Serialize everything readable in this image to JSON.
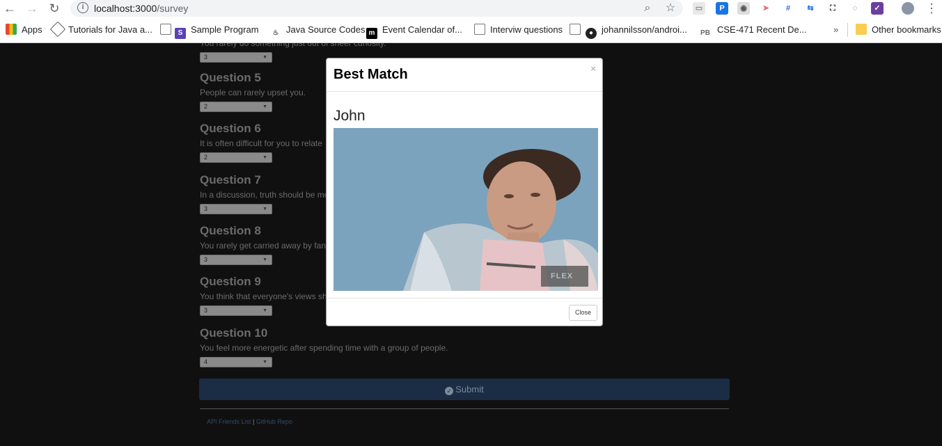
{
  "browser": {
    "url_host": "localhost:3000",
    "url_path": "/survey",
    "bookmarks": [
      {
        "label": "Apps"
      },
      {
        "label": "Tutorials for Java a..."
      },
      {
        "label": "Sample Program"
      },
      {
        "label": "Java Source Codes"
      },
      {
        "label": "Event Calendar of..."
      },
      {
        "label": "Interviw questions"
      },
      {
        "label": "johannilsson/androi..."
      },
      {
        "label": "CSE-471 Recent De..."
      }
    ],
    "overflow": "»",
    "other_bookmarks": "Other bookmarks"
  },
  "survey": {
    "partial_text": "You rarely do something just out of sheer curiosity.",
    "partial_value": "3",
    "questions": [
      {
        "title": "Question 5",
        "text": "People can rarely upset you.",
        "value": "2"
      },
      {
        "title": "Question 6",
        "text": "It is often difficult for you to relate",
        "value": "2"
      },
      {
        "title": "Question 7",
        "text": "In a discussion, truth should be mo",
        "value": "3"
      },
      {
        "title": "Question 8",
        "text": "You rarely get carried away by fan",
        "value": "3"
      },
      {
        "title": "Question 9",
        "text": "You think that everyone's views sh",
        "value": "3"
      },
      {
        "title": "Question 10",
        "text": "You feel more energetic after spending time with a group of people.",
        "value": "4"
      }
    ],
    "submit_label": "Submit",
    "footer_link1": "API Friends List",
    "footer_sep": "|",
    "footer_link2": "GitHub Repo"
  },
  "modal": {
    "title": "Best Match",
    "close_x": "×",
    "name": "John",
    "close_label": "Close",
    "photo_watermark": "FLEX"
  },
  "colors": {
    "page_bg": "#111010",
    "submit_bg": "#1a2d44",
    "modal_bg": "#ffffff"
  }
}
